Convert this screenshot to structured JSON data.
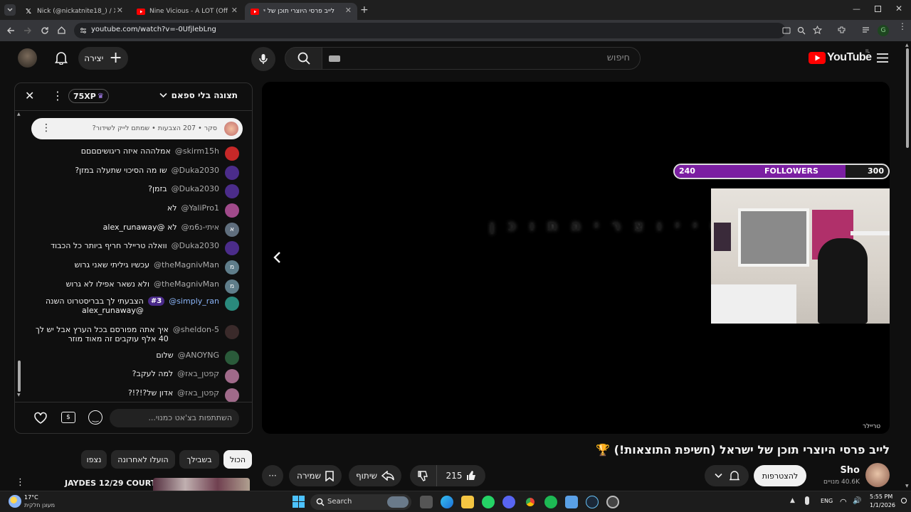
{
  "browser": {
    "tabs": [
      {
        "title": "Nick (@nickatnite18_) / X",
        "active": false
      },
      {
        "title": "Nine Vicious - A LOT (Official M",
        "active": false
      },
      {
        "title": "לייב פרסי היוצרי תוכן של יש",
        "active": true
      }
    ],
    "url": "youtube.com/watch?v=-0UfjlebLng"
  },
  "youtube": {
    "logo_text": "YouTube",
    "country": "IL",
    "search_placeholder": "חיפוש",
    "create_label": "יצירה",
    "chat": {
      "header_title": "תצוגה בלי ספאם",
      "xp_badge": "75XP",
      "pinned_text": "סקר • 207 הצבעות • שמתם לייק לשידור?",
      "messages": [
        {
          "author": "@skirm15h",
          "text": "אמלההה איזה ריגושיםםםם",
          "color": "#c62828",
          "initial": ""
        },
        {
          "author": "@Duka2030",
          "text": "שו מה הסיכוי שתעלה במזן?",
          "color": "#4b2c8a",
          "initial": ""
        },
        {
          "author": "@Duka2030",
          "text": "בזמן?",
          "color": "#4b2c8a",
          "initial": ""
        },
        {
          "author": "@YaliPro1",
          "text": "לא",
          "color": "#a04a8a",
          "initial": ""
        },
        {
          "author": "@איתי-נ6מ",
          "text": "לא @alex_runaway",
          "color": "#5f6e7d",
          "initial": "א"
        },
        {
          "author": "@Duka2030",
          "text": "וואלה טריילר חריף ביותר כל הכבוד",
          "color": "#4b2c8a",
          "initial": ""
        },
        {
          "author": "@theMagnivMan",
          "text": "עכשיו גיליתי שאני גרוש",
          "color": "#5f7d8a",
          "initial": "מ"
        },
        {
          "author": "@theMagnivMan",
          "text": "ולא נשאר אפילו לא גרוש",
          "color": "#5f7d8a",
          "initial": "מ"
        },
        {
          "author": "@simply_ran",
          "text": "הצבעתי לך בבריסטרוט השנה @alex_runaway",
          "color": "#2a8a7d",
          "initial": "",
          "badge": "#3"
        },
        {
          "author": "@sheldon-5",
          "text": "איך אתה מפורסם בכל הערץ אבל יש לך 40 אלף עוקבים זה מאוד מוזר",
          "color": "#3a2a2a",
          "initial": ""
        },
        {
          "author": "@ANOYNG",
          "text": "שלום",
          "color": "#2a5a3a",
          "initial": ""
        },
        {
          "author": "@קפטן_באז",
          "text": "למה לעקב?",
          "color": "#a06a8a",
          "initial": ""
        },
        {
          "author": "@קפטן_באז",
          "text": "אדון של?!?!?",
          "color": "#a06a8a",
          "initial": ""
        }
      ],
      "input_placeholder": "השתתפות בצ'אט כמנוי..."
    },
    "video": {
      "overlay_text": "ס י  י ו צ ר י  ה ת ו כ ן",
      "followers_label": "FOLLOWERS",
      "followers_current": "240",
      "followers_goal": "300",
      "followers_progress": 0.8,
      "corner_label": "טריילר"
    },
    "title": "לייב פרסי היוצרי תוכן של ישראל (חשיפת התוצאות!) 🏆",
    "channel": {
      "name": "Sho",
      "subs": "40.6K מנויים",
      "join_label": "להצטרפות"
    },
    "actions": {
      "likes": "215",
      "share": "שיתוף",
      "save": "שמירה"
    },
    "chips": [
      "הכול",
      "בשבילך",
      "הועלו לאחרונה",
      "נצפו"
    ],
    "next_video": "JAYDES 12/29 COURT"
  },
  "taskbar": {
    "weather_temp": "17°C",
    "weather_text": "מעונן חלקית",
    "search_label": "Search",
    "lang": "ENG",
    "time": "5:55 PM",
    "date": "1/1/2026"
  },
  "colors": {
    "accent_purple": "#7b1fa2",
    "yt_red": "#ff0000",
    "bg": "#0f0f0f"
  }
}
